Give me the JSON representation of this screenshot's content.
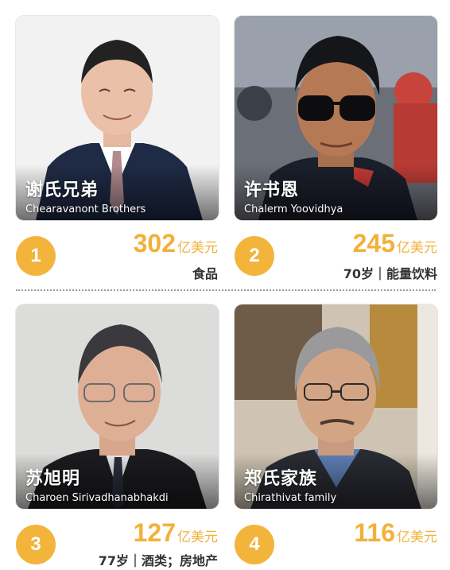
{
  "entries": [
    {
      "rank": "1",
      "name_zh": "谢氏兄弟",
      "name_en": "Chearavanont Brothers",
      "worth": "302",
      "unit": "亿美元",
      "detail": "食品"
    },
    {
      "rank": "2",
      "name_zh": "许书恩",
      "name_en": "Chalerm Yoovidhya",
      "worth": "245",
      "unit": "亿美元",
      "detail": "70岁｜能量饮料"
    },
    {
      "rank": "3",
      "name_zh": "苏旭明",
      "name_en": "Charoen Sirivadhanabhakdi",
      "worth": "127",
      "unit": "亿美元",
      "detail": "77岁｜酒类；房地产"
    },
    {
      "rank": "4",
      "name_zh": "郑氏家族",
      "name_en": "Chirathivat family",
      "worth": "116",
      "unit": "亿美元",
      "detail": ""
    }
  ],
  "colors": {
    "accent": "#f3b43c",
    "accent_text": "#f2b13a",
    "detail_text": "#333333"
  }
}
